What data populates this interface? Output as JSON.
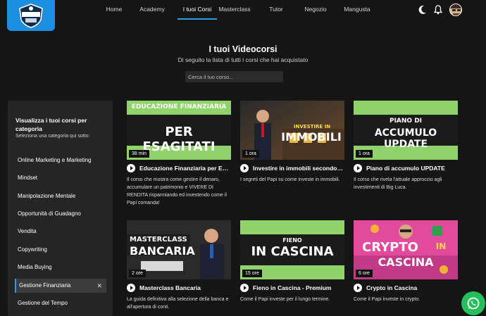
{
  "header": {
    "nav": [
      {
        "label": "Home",
        "active": false
      },
      {
        "label": "Academy",
        "active": false
      },
      {
        "label": "I tuoi Corsi",
        "active": true
      },
      {
        "label": "Masterclass",
        "active": false
      },
      {
        "label": "Tutor",
        "active": false
      },
      {
        "label": "Negozio",
        "active": false
      },
      {
        "label": "Mangusta",
        "active": false
      }
    ],
    "icons": [
      "logo-shield-icon",
      "moon-icon",
      "bell-icon",
      "avatar"
    ]
  },
  "intro": {
    "title": "I tuoi Videocorsi",
    "subtitle": "Di seguito la lista di tutti i corsi che hai acquistato",
    "search_placeholder": "Cerca il tuo corso..."
  },
  "sidebar": {
    "title": "Visualizza i tuoi corsi per categoria",
    "subtitle": "Seleziona una categoria qui sotto:",
    "categories": [
      {
        "label": "Online Marketing e Marketing",
        "active": false
      },
      {
        "label": "Mindset",
        "active": false
      },
      {
        "label": "Manipolazione Mentale",
        "active": false
      },
      {
        "label": "Opportunità di Guadagno",
        "active": false
      },
      {
        "label": "Vendita",
        "active": false
      },
      {
        "label": "Copywriting",
        "active": false
      },
      {
        "label": "Media Buying",
        "active": false
      },
      {
        "label": "Gestione Finanziaria",
        "active": true
      },
      {
        "label": "Gestione del Tempo",
        "active": false
      }
    ],
    "clear_symbol": "✕"
  },
  "courses": [
    {
      "thumb_lines": [
        "EDUCAZIONE FINANZIARIA",
        "PER ESAGITATI"
      ],
      "duration": "38 min",
      "title": "Educazione Finanziaria per Esagitati",
      "description": "Il corso che mostra come gestire il denaro, accumulare un patrimonio e VIVERE DI RENDITA risparmiando ed investendo come il Papi comanda!"
    },
    {
      "thumb_lines": [
        "INVESTIRE IN",
        "IMMOBILI"
      ],
      "duration": "1 ora",
      "title": "Investire in immobili secondo il Papi",
      "description": "I segreti del Papi su come investe in immobili."
    },
    {
      "thumb_lines": [
        "PIANO DI",
        "ACCUMULO UPDATE"
      ],
      "duration": "1 ora",
      "title": "Piano di accumulo UPDATE",
      "description": "Il corso che rivela l'attuale approccio agli investimenti di Big Luca."
    },
    {
      "thumb_lines": [
        "MASTERCLASS",
        "BANCARIA"
      ],
      "duration": "2 ore",
      "title": "Masterclass Bancaria",
      "description": "La guida definitiva alla selezione della banca e all'apertura di conti."
    },
    {
      "thumb_lines": [
        "FIENO",
        "IN CASCINA"
      ],
      "duration": "15 ore",
      "title": "Fieno in Cascina - Premium",
      "description": "Come il Papi investe per il lungo termine."
    },
    {
      "thumb_lines": [
        "CRYPTO",
        "IN",
        "CASCINA"
      ],
      "duration": "6 ore",
      "title": "Crypto in Cascina",
      "description": "Come il Papi investe in crypto."
    }
  ],
  "colors": {
    "accent": "#2a9fe8",
    "background": "#151515",
    "sidebar": "#252525",
    "thumb_green": "#8fd36a",
    "whatsapp": "#25c05a"
  }
}
